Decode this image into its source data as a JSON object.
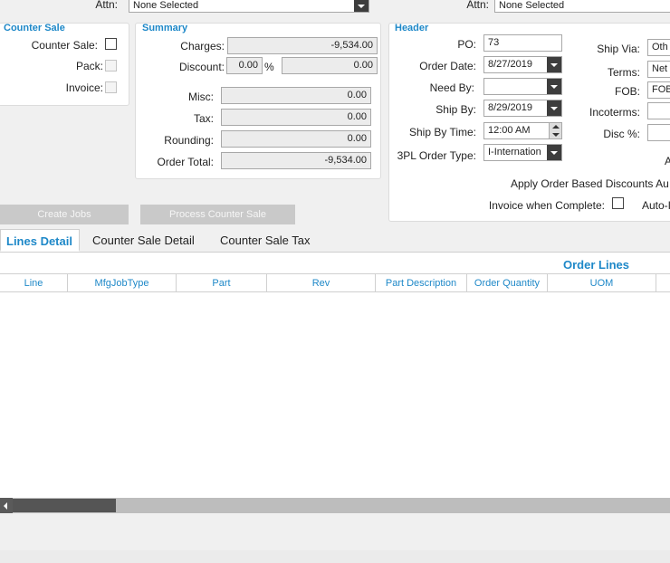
{
  "top": {
    "attn_label": "Attn:",
    "attn_left_value": "None Selected",
    "attn_right_value": "None Selected"
  },
  "counter_sale": {
    "title": "Counter Sale",
    "counter_sale_label": "Counter Sale:",
    "pack_label": "Pack:",
    "invoice_label": "Invoice:"
  },
  "summary": {
    "title": "Summary",
    "charges_label": "Charges:",
    "charges_value": "-9,534.00",
    "discount_label": "Discount:",
    "discount_pct": "0.00",
    "pct_sign": "%",
    "discount_value": "0.00",
    "misc_label": "Misc:",
    "misc_value": "0.00",
    "tax_label": "Tax:",
    "tax_value": "0.00",
    "rounding_label": "Rounding:",
    "rounding_value": "0.00",
    "order_total_label": "Order Total:",
    "order_total_value": "-9,534.00"
  },
  "header": {
    "title": "Header",
    "po_label": "PO:",
    "po_value": "73",
    "order_date_label": "Order Date:",
    "order_date_value": "8/27/2019",
    "need_by_label": "Need By:",
    "need_by_value": "",
    "ship_by_label": "Ship By:",
    "ship_by_value": "8/29/2019",
    "ship_by_time_label": "Ship By Time:",
    "ship_by_time_value": "12:00 AM",
    "tpl_label": "3PL Order Type:",
    "tpl_value": "I-Internation",
    "ship_via_label": "Ship Via:",
    "ship_via_value": "Oth",
    "terms_label": "Terms:",
    "terms_value": "Net",
    "fob_label": "FOB:",
    "fob_value": "FOB",
    "incoterms_label": "Incoterms:",
    "incoterms_value": "",
    "disc_label": "Disc %:",
    "disc_value": "",
    "a_label": "A",
    "apply_discounts_label": "Apply Order Based Discounts Au",
    "invoice_complete_label": "Invoice when Complete:",
    "auto_label": "Auto-I"
  },
  "buttons": {
    "create_jobs": "Create Jobs",
    "process_counter_sale": "Process Counter Sale"
  },
  "tabs": [
    "Lines Detail",
    "Counter Sale Detail",
    "Counter Sale Tax"
  ],
  "grid": {
    "title": "Order Lines",
    "columns": [
      "Line",
      "MfgJobType",
      "Part",
      "Rev",
      "Part Description",
      "Order Quantity",
      "UOM"
    ]
  },
  "colors": {
    "accent": "#1e88c8",
    "button_disabled": "#c9c9c9"
  }
}
